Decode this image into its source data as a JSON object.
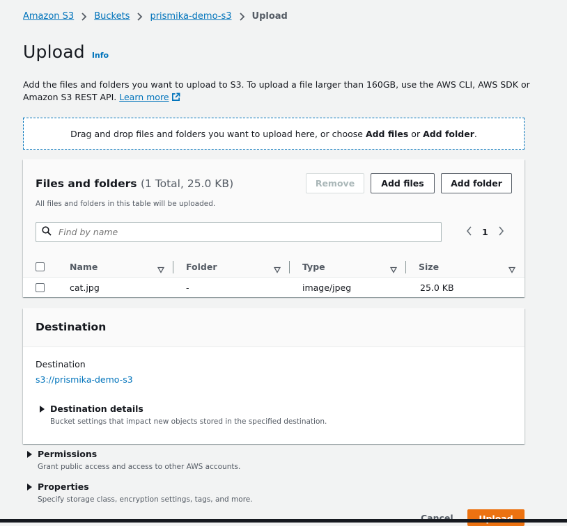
{
  "breadcrumb": {
    "items": [
      "Amazon S3",
      "Buckets",
      "prismika-demo-s3"
    ],
    "current": "Upload"
  },
  "header": {
    "title": "Upload",
    "info": "Info"
  },
  "description": {
    "text": "Add the files and folders you want to upload to S3. To upload a file larger than 160GB, use the AWS CLI, AWS SDK or Amazon S3 REST API.",
    "learn_more": "Learn more"
  },
  "dropzone": {
    "prefix": "Drag and drop files and folders you want to upload here, or choose ",
    "add_files": "Add files",
    "middle": " or ",
    "add_folder": "Add folder",
    "suffix": "."
  },
  "files_panel": {
    "title": "Files and folders",
    "count": "(1 Total, 25.0 KB)",
    "subtitle": "All files and folders in this table will be uploaded.",
    "buttons": {
      "remove": "Remove",
      "add_files": "Add files",
      "add_folder": "Add folder"
    },
    "search": {
      "placeholder": "Find by name"
    },
    "page": "1",
    "columns": [
      "Name",
      "Folder",
      "Type",
      "Size"
    ],
    "rows": [
      {
        "name": "cat.jpg",
        "folder": "-",
        "type": "image/jpeg",
        "size": "25.0 KB"
      }
    ]
  },
  "destination": {
    "title": "Destination",
    "label": "Destination",
    "uri": "s3://prismika-demo-s3",
    "details_title": "Destination details",
    "details_desc": "Bucket settings that impact new objects stored in the specified destination."
  },
  "permissions": {
    "title": "Permissions",
    "desc": "Grant public access and access to other AWS accounts."
  },
  "properties": {
    "title": "Properties",
    "desc": "Specify storage class, encryption settings, tags, and more."
  },
  "footer": {
    "cancel": "Cancel",
    "upload": "Upload"
  },
  "colors": {
    "link": "#0073bb",
    "primary": "#ec7211",
    "text": "#16191f",
    "secondary_text": "#545b64",
    "background": "#f2f3f3"
  }
}
